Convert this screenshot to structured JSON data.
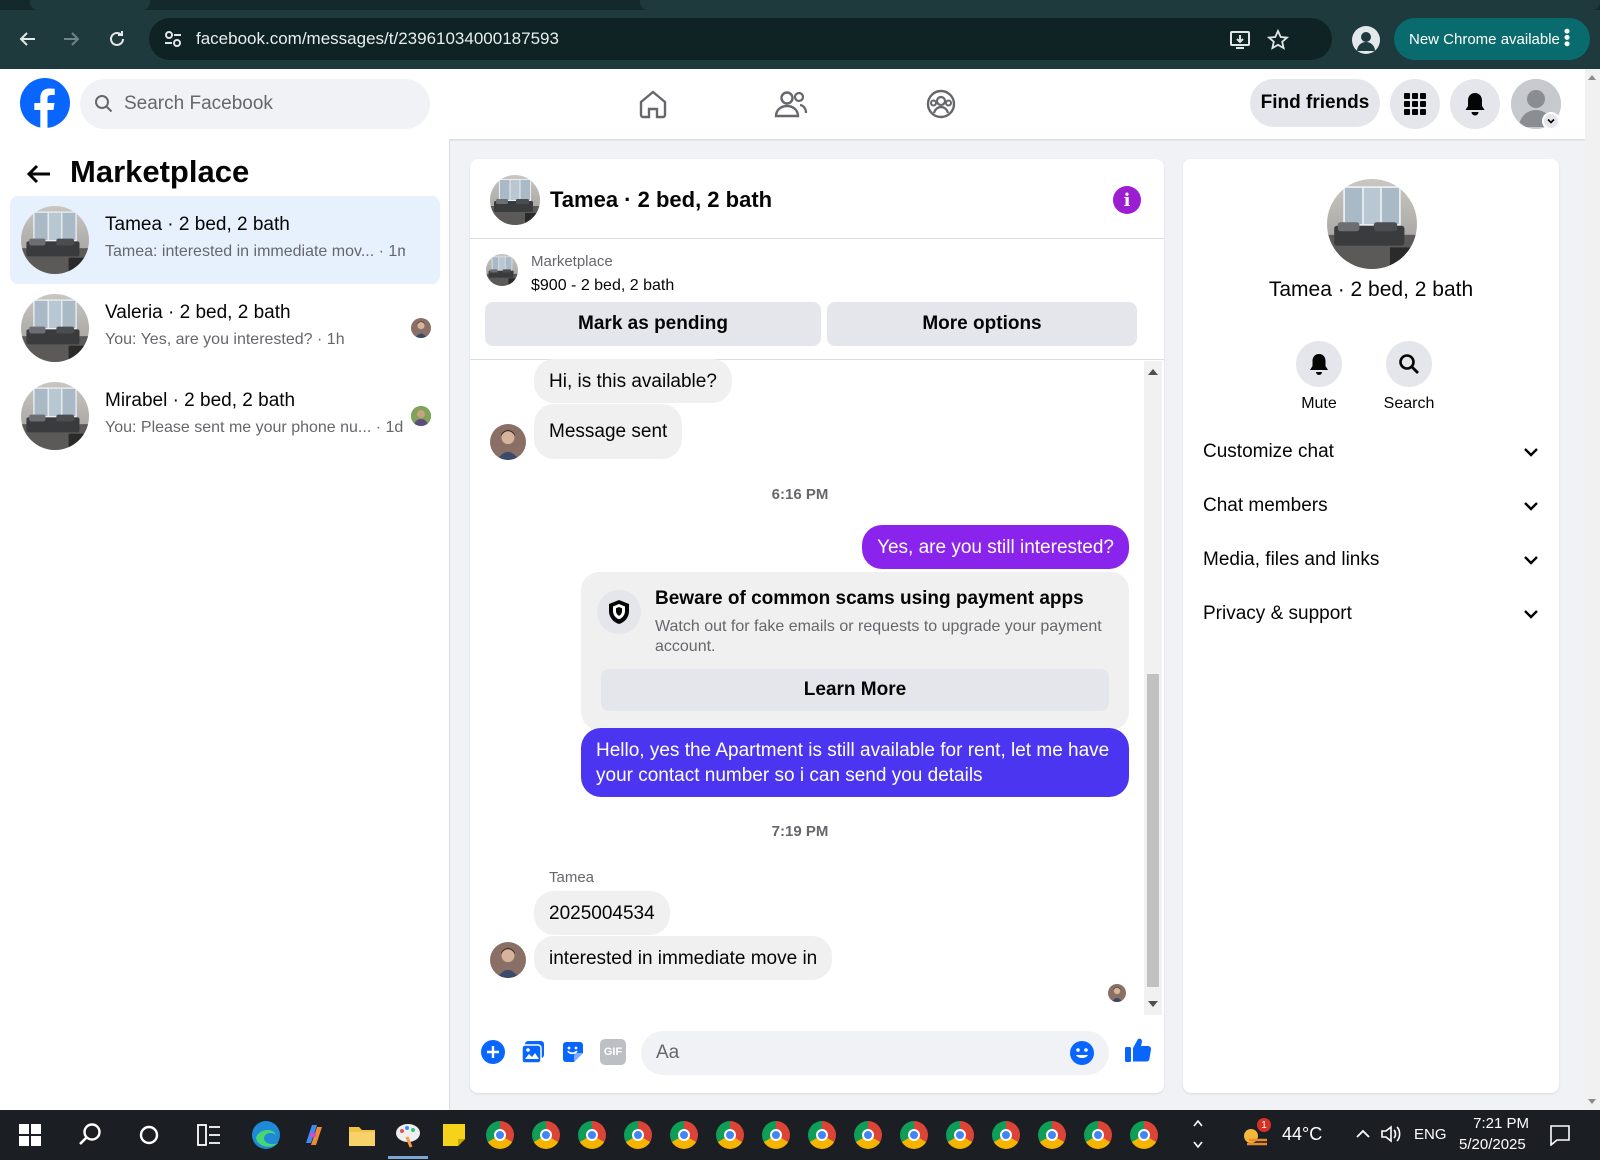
{
  "browser": {
    "url": "facebook.com/messages/t/23961034000187593",
    "update_label": "New Chrome available",
    "icons": [
      "back-arrow-icon",
      "forward-arrow-icon",
      "reload-icon",
      "site-settings-icon",
      "install-app-icon",
      "bookmark-star-icon",
      "profile-icon",
      "menu-dots-icon"
    ]
  },
  "header": {
    "search_placeholder": "Search Facebook",
    "find_friends_label": "Find friends",
    "nav_icons": [
      "home-icon",
      "friends-icon",
      "groups-icon"
    ],
    "accent": "#0866ff"
  },
  "sidebar": {
    "title": "Marketplace",
    "conversations": [
      {
        "name": "Tamea · 2 bed, 2 bath",
        "preview": "Tamea: interested in immediate mov...",
        "time": "· 1m",
        "active": true
      },
      {
        "name": "Valeria · 2 bed, 2 bath",
        "preview": "You: Yes, are you interested?",
        "time": "· 1h",
        "active": false
      },
      {
        "name": "Mirabel · 2 bed, 2 bath",
        "preview": "You: Please sent me your phone nu...",
        "time": "· 1d",
        "active": false
      }
    ]
  },
  "chat": {
    "title": "Tamea · 2 bed, 2 bath",
    "listing": {
      "source": "Marketplace",
      "price_title": "$900 - 2 bed, 2 bath",
      "pending_label": "Mark as pending",
      "more_label": "More options"
    },
    "messages": {
      "m1": "Hi, is this available?",
      "m2": "Message sent",
      "time1": "6:16 PM",
      "m3": "Yes, are you still interested?",
      "scam_title": "Beware of common scams using payment apps",
      "scam_body": "Watch out for fake emails or requests to upgrade your payment account.",
      "learn_more": "Learn More",
      "m4": "Hello, yes the Apartment is still available for rent, let me have your contact number so i can send you details",
      "time2": "7:19 PM",
      "sender": "Tamea",
      "m5": "2025004534",
      "m6": "interested in immediate move in"
    },
    "composer_placeholder": "Aa",
    "colors": {
      "outgoing_1": "#8a24ec",
      "outgoing_2": "#4c35f0",
      "info": "#9c1ed1"
    }
  },
  "details": {
    "name": "Tamea · 2 bed, 2 bath",
    "actions": [
      {
        "label": "Mute",
        "icon": "bell-icon"
      },
      {
        "label": "Search",
        "icon": "search-icon"
      }
    ],
    "sections": [
      "Customize chat",
      "Chat members",
      "Media, files and links",
      "Privacy & support"
    ]
  },
  "taskbar": {
    "weather": "44°C",
    "language": "ENG",
    "time": "7:21 PM",
    "date": "5/20/2025",
    "weather_badge": "1"
  }
}
